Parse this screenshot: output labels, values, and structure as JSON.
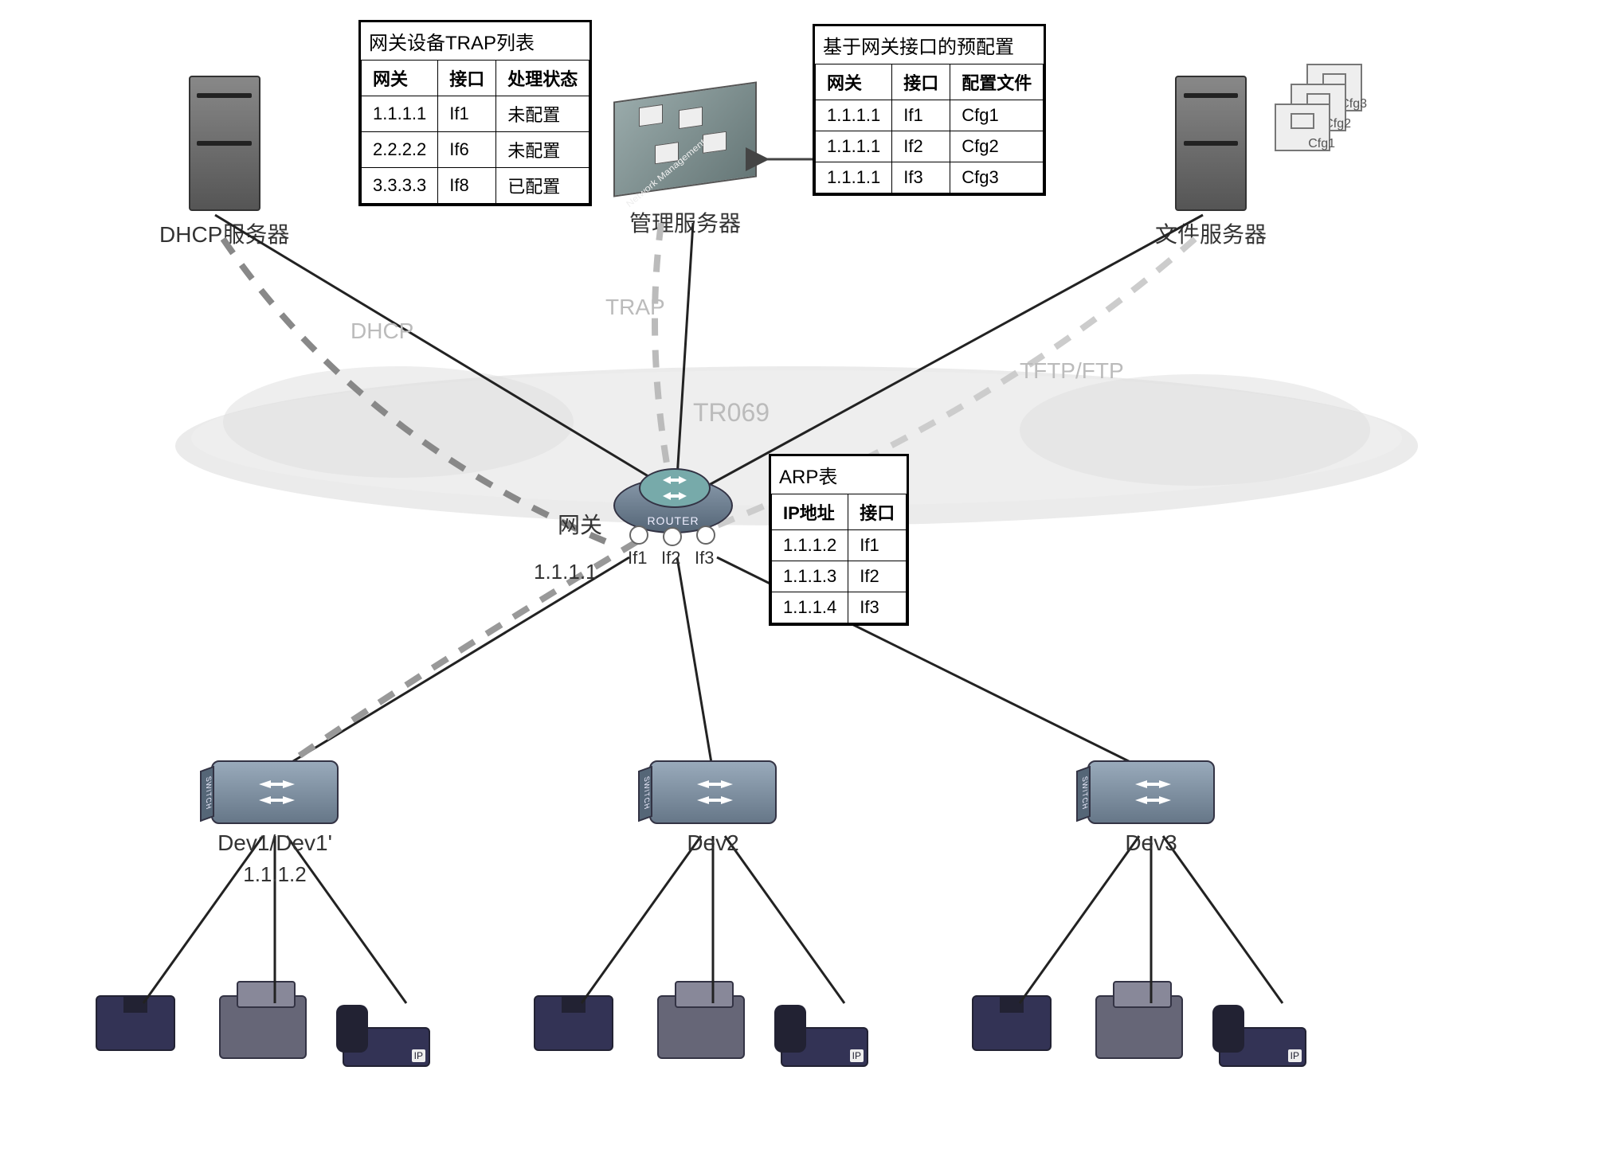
{
  "servers": {
    "dhcp": {
      "label": "DHCP服务器"
    },
    "mgmt": {
      "label": "管理服务器",
      "inner_label": "Network Management"
    },
    "file": {
      "label": "文件服务器"
    }
  },
  "files": {
    "f1": "Cfg1",
    "f2": "Cfg2",
    "f3": "Cfg3"
  },
  "tables": {
    "trap": {
      "title": "网关设备TRAP列表",
      "headers": {
        "h1": "网关",
        "h2": "接口",
        "h3": "处理状态"
      },
      "rows": [
        {
          "c1": "1.1.1.1",
          "c2": "If1",
          "c3": "未配置"
        },
        {
          "c1": "2.2.2.2",
          "c2": "If6",
          "c3": "未配置"
        },
        {
          "c1": "3.3.3.3",
          "c2": "If8",
          "c3": "已配置"
        }
      ]
    },
    "precfg": {
      "title": "基于网关接口的预配置",
      "headers": {
        "h1": "网关",
        "h2": "接口",
        "h3": "配置文件"
      },
      "rows": [
        {
          "c1": "1.1.1.1",
          "c2": "If1",
          "c3": "Cfg1"
        },
        {
          "c1": "1.1.1.1",
          "c2": "If2",
          "c3": "Cfg2"
        },
        {
          "c1": "1.1.1.1",
          "c2": "If3",
          "c3": "Cfg3"
        }
      ]
    },
    "arp": {
      "title": "ARP表",
      "headers": {
        "h1": "IP地址",
        "h2": "接口"
      },
      "rows": [
        {
          "c1": "1.1.1.2",
          "c2": "If1"
        },
        {
          "c1": "1.1.1.3",
          "c2": "If2"
        },
        {
          "c1": "1.1.1.4",
          "c2": "If3"
        }
      ]
    }
  },
  "router": {
    "label": "网关",
    "inner": "ROUTER",
    "ip": "1.1.1.1",
    "ports": {
      "p1": "If1",
      "p2": "If2",
      "p3": "If3"
    }
  },
  "switches": {
    "side": "SWITCH",
    "s1": {
      "label": "Dev1/Dev1'",
      "ip": "1.1.1.2"
    },
    "s2": {
      "label": "Dev2"
    },
    "s3": {
      "label": "Dev3"
    }
  },
  "protocols": {
    "dhcp": "DHCP",
    "trap": "TRAP",
    "tr069": "TR069",
    "tftp": "TFTP/FTP"
  },
  "ipphone": {
    "tag": "IP"
  }
}
